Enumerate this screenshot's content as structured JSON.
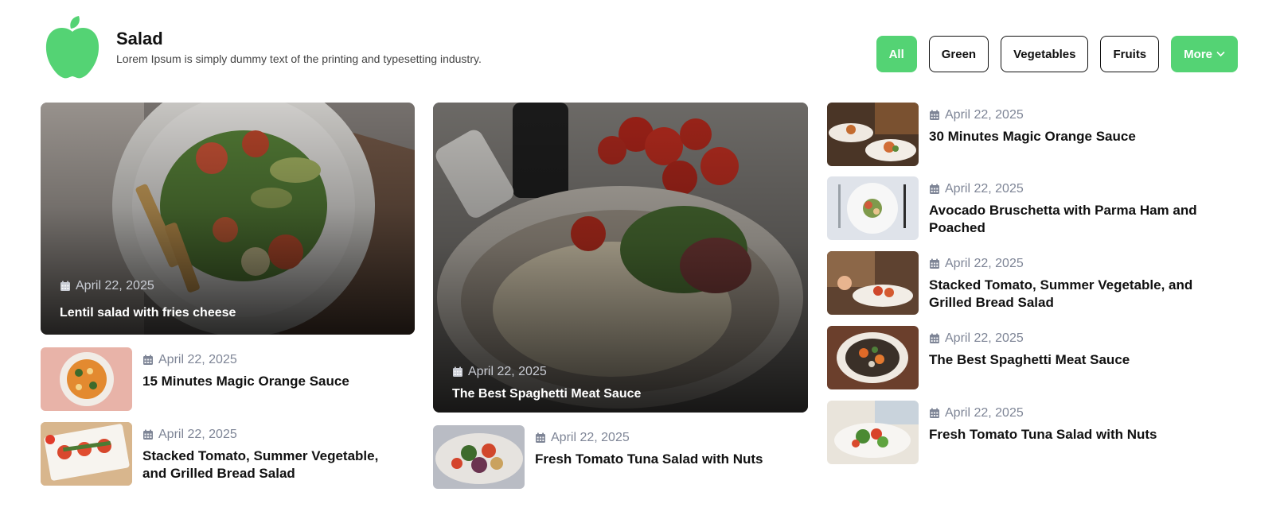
{
  "brand": {
    "title": "Salad",
    "subtitle": "Lorem Ipsum is simply dummy text of the printing and typesetting industry.",
    "logo_icon": "apple-icon",
    "accent": "#54d374"
  },
  "filters": [
    {
      "label": "All",
      "active": true
    },
    {
      "label": "Green",
      "active": false
    },
    {
      "label": "Vegetables",
      "active": false
    },
    {
      "label": "Fruits",
      "active": false
    },
    {
      "label": "More",
      "active": false
    }
  ],
  "features": [
    {
      "date": "April 22, 2025",
      "title": "Lentil salad with fries cheese"
    },
    {
      "date": "April 22, 2025",
      "title": "The Best Spaghetti Meat Sauce"
    }
  ],
  "col1_items": [
    {
      "date": "April 22, 2025",
      "title": "15 Minutes Magic Orange Sauce"
    },
    {
      "date": "April 22, 2025",
      "title": "Stacked Tomato, Summer Vegetable, and Grilled Bread Salad"
    }
  ],
  "col2_items": [
    {
      "date": "April 22, 2025",
      "title": "Fresh Tomato Tuna Salad with Nuts"
    }
  ],
  "col3_items": [
    {
      "date": "April 22, 2025",
      "title": "30 Minutes Magic Orange Sauce"
    },
    {
      "date": "April 22, 2025",
      "title": "Avocado Bruschetta with Parma Ham and Poached"
    },
    {
      "date": "April 22, 2025",
      "title": "Stacked Tomato, Summer Vegetable, and Grilled Bread Salad"
    },
    {
      "date": "April 22, 2025",
      "title": "The Best Spaghetti Meat Sauce"
    },
    {
      "date": "April 22, 2025",
      "title": "Fresh Tomato Tuna Salad with Nuts"
    }
  ]
}
